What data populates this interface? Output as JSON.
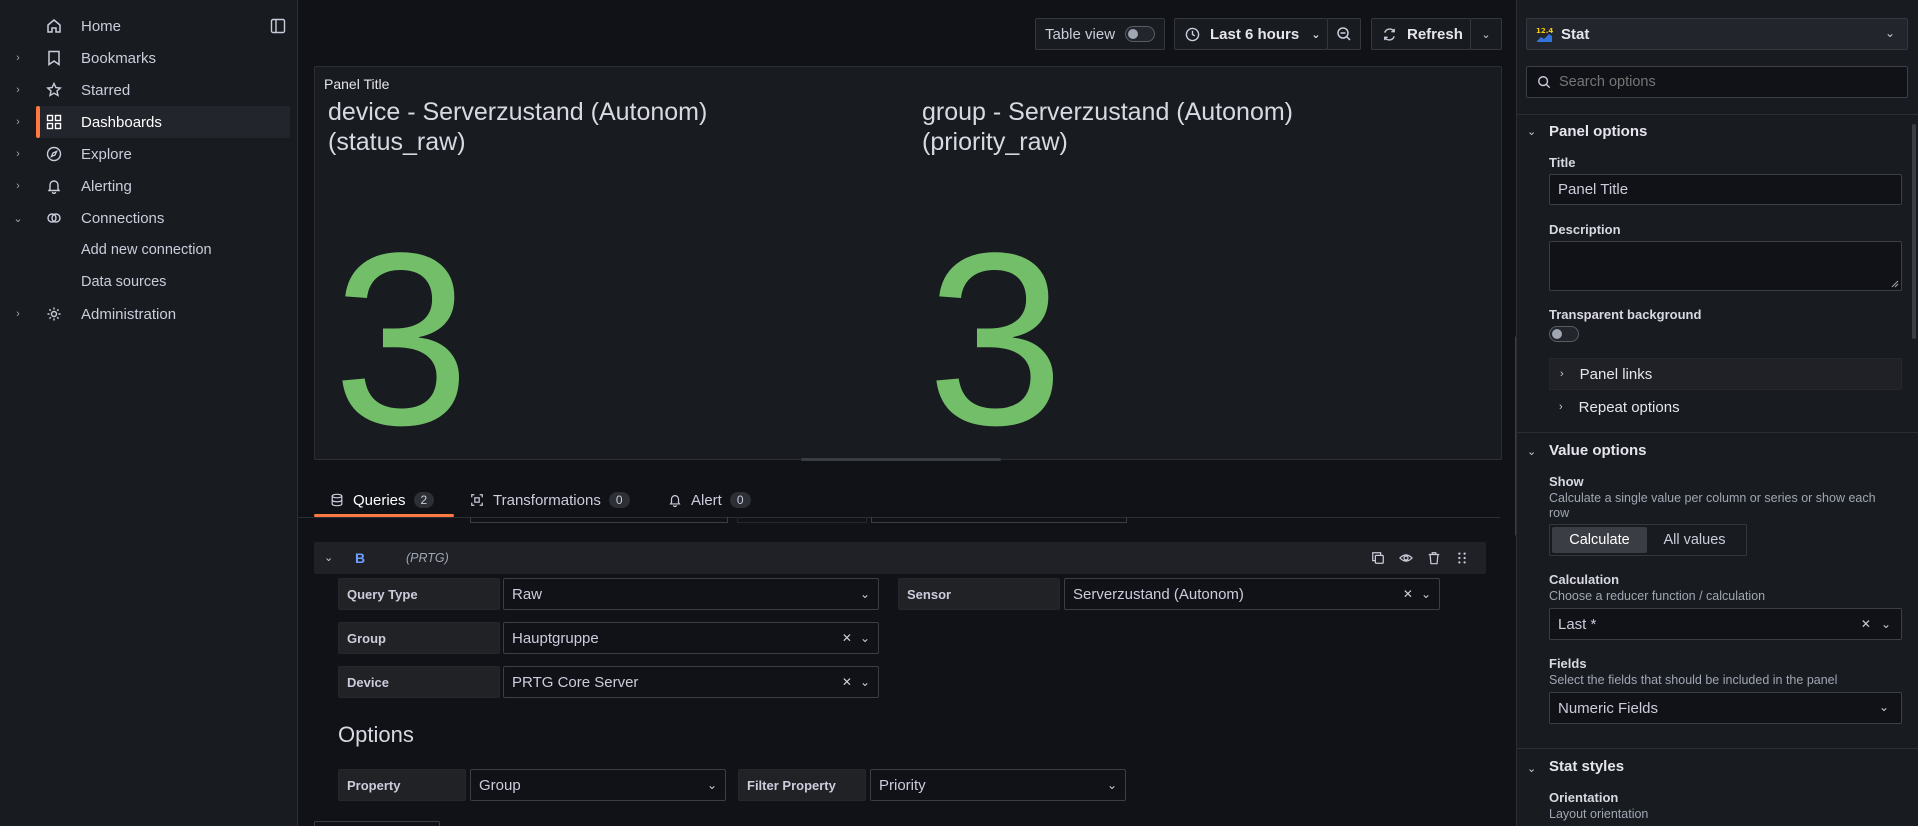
{
  "nav": {
    "home": "Home",
    "bookmarks": "Bookmarks",
    "starred": "Starred",
    "dashboards": "Dashboards",
    "explore": "Explore",
    "alerting": "Alerting",
    "connections": "Connections",
    "add_new_connection": "Add new connection",
    "data_sources": "Data sources",
    "administration": "Administration"
  },
  "toolbar": {
    "table_view": "Table view",
    "time_range": "Last 6 hours",
    "refresh": "Refresh"
  },
  "panel": {
    "title": "Panel Title",
    "stats": [
      {
        "line1": "device - Serverzustand (Autonom)",
        "line2": "(status_raw)",
        "value": "3"
      },
      {
        "line1": "group - Serverzustand (Autonom)",
        "line2": "(priority_raw)",
        "value": "3"
      }
    ],
    "value_color": "#73bf69"
  },
  "tabs": [
    {
      "label": "Queries",
      "count": "2"
    },
    {
      "label": "Transformations",
      "count": "0"
    },
    {
      "label": "Alert",
      "count": "0"
    }
  ],
  "query": {
    "ref_id": "B",
    "datasource": "(PRTG)",
    "query_type_label": "Query Type",
    "query_type_value": "Raw",
    "sensor_label": "Sensor",
    "sensor_value": "Serverzustand (Autonom)",
    "group_label": "Group",
    "group_value": "Hauptgruppe",
    "device_label": "Device",
    "device_value": "PRTG Core Server",
    "options_heading": "Options",
    "property_label": "Property",
    "property_value": "Group",
    "filter_property_label": "Filter Property",
    "filter_property_value": "Priority"
  },
  "options": {
    "viz_name": "Stat",
    "search_placeholder": "Search options",
    "panel_options": "Panel options",
    "title_label": "Title",
    "title_value": "Panel Title",
    "description_label": "Description",
    "transparent_label": "Transparent background",
    "panel_links": "Panel links",
    "repeat_options": "Repeat options",
    "value_options": "Value options",
    "show_label": "Show",
    "show_desc": "Calculate a single value per column or series or show each row",
    "calculate": "Calculate",
    "all_values": "All values",
    "calculation_label": "Calculation",
    "calculation_desc": "Choose a reducer function / calculation",
    "calculation_value": "Last *",
    "fields_label": "Fields",
    "fields_desc": "Select the fields that should be included in the panel",
    "fields_value": "Numeric Fields",
    "stat_styles": "Stat styles",
    "orientation_label": "Orientation",
    "orientation_desc": "Layout orientation"
  },
  "colors": {
    "accent": "#ff7941",
    "stat_green": "#73bf69",
    "ref_blue": "#6e9fff"
  }
}
